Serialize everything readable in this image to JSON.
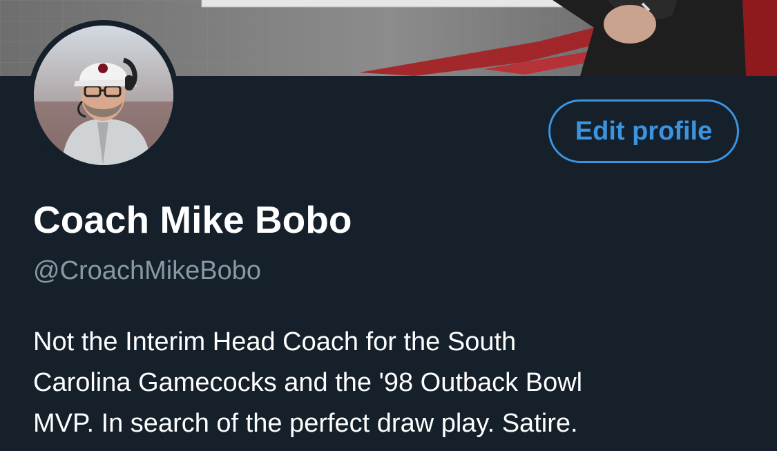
{
  "header": {
    "banner_description": "banner-image"
  },
  "profile": {
    "avatar": "avatar-photo",
    "display_name": "Coach Mike Bobo",
    "handle": "@CroachMikeBobo",
    "bio_lines": [
      "Not the Interim Head Coach for the South",
      "Carolina Gamecocks and the '98 Outback Bowl",
      "MVP. In search of the perfect draw play. Satire."
    ]
  },
  "actions": {
    "edit_profile_label": "Edit profile"
  },
  "colors": {
    "background": "#15202b",
    "accent": "#3b94e0",
    "text_primary": "#ffffff",
    "text_secondary": "#8899a6"
  }
}
